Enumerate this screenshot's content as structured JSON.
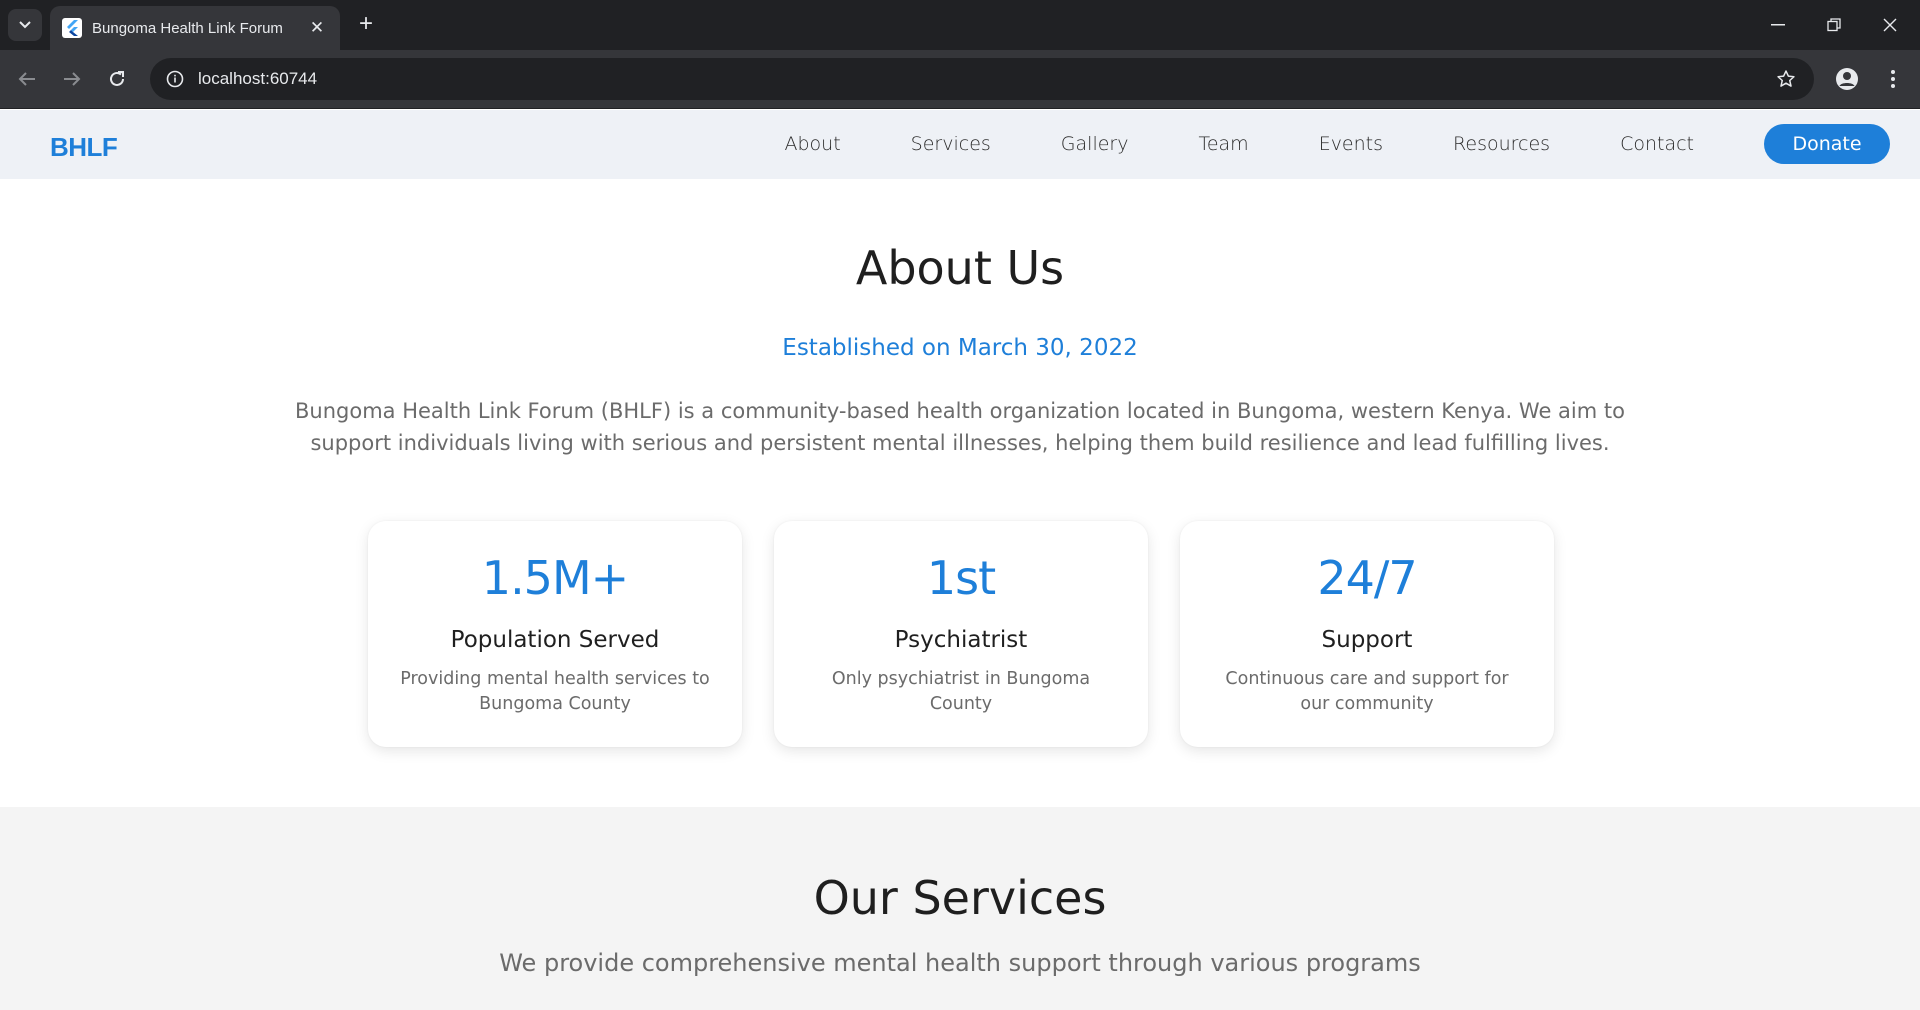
{
  "browser": {
    "tab_title": "Bungoma Health Link Forum",
    "url": "localhost:60744",
    "icons": [
      "tab-search-icon",
      "close-icon",
      "plus-icon",
      "minimize-icon",
      "restore-icon",
      "window-close-icon",
      "back-icon",
      "forward-icon",
      "reload-icon",
      "info-icon",
      "star-icon",
      "profile-icon",
      "kebab-menu-icon"
    ]
  },
  "site": {
    "logo": "BHLF",
    "nav": [
      "About",
      "Services",
      "Gallery",
      "Team",
      "Events",
      "Resources",
      "Contact"
    ],
    "donate_label": "Donate",
    "accent_color": "#1e7fd9"
  },
  "about": {
    "title": "About Us",
    "established": "Established on March 30, 2022",
    "intro": "Bungoma Health Link Forum (BHLF) is a community-based health organization located in Bungoma, western Kenya. We aim to support individuals living with serious and persistent mental illnesses, helping them build resilience and lead fulfilling lives.",
    "stats": [
      {
        "value": "1.5M+",
        "label": "Population Served",
        "desc": "Providing mental health services to Bungoma County"
      },
      {
        "value": "1st",
        "label": "Psychiatrist",
        "desc": "Only psychiatrist in Bungoma County"
      },
      {
        "value": "24/7",
        "label": "Support",
        "desc": "Continuous care and support for our community"
      }
    ]
  },
  "services": {
    "title": "Our Services",
    "subtitle": "We provide comprehensive mental health support through various programs"
  }
}
